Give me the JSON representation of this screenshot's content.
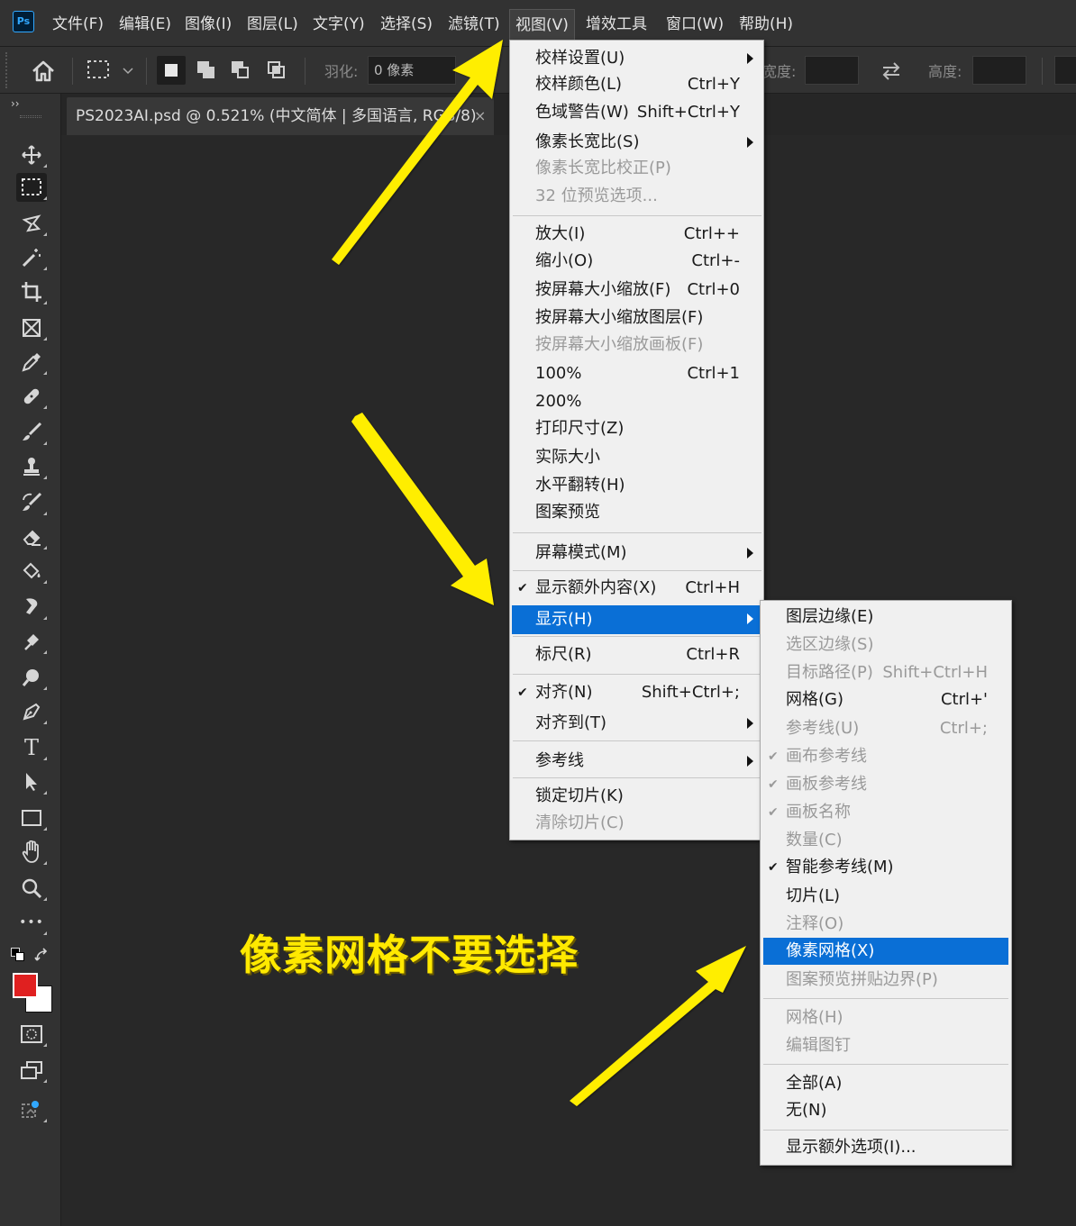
{
  "colors": {
    "accent": "#0a6fd6",
    "annotation": "#ffe900",
    "foreground_swatch": "#e02020",
    "ps_blue": "#31a8ff"
  },
  "app": {
    "logo_text": "Ps"
  },
  "menubar": {
    "items": [
      "文件(F)",
      "编辑(E)",
      "图像(I)",
      "图层(L)",
      "文字(Y)",
      "选择(S)",
      "滤镜(T)",
      "视图(V)",
      "增效工具",
      "窗口(W)",
      "帮助(H)"
    ]
  },
  "options": {
    "feather_label": "羽化:",
    "feather_value": "0 像素",
    "width_label": "宽度:",
    "height_label": "高度:",
    "collapse": "››"
  },
  "document": {
    "tab_title": "PS2023AI.psd @ 0.521% (中文简体 | 多国语言, RGB/8)",
    "close": "×"
  },
  "tools": {
    "icons": [
      "move-tool-icon",
      "marquee-tool-icon",
      "lasso-tool-icon",
      "magic-wand-icon",
      "crop-tool-icon",
      "frame-tool-icon",
      "eyedropper-icon",
      "healing-brush-icon",
      "brush-tool-icon",
      "clone-stamp-icon",
      "history-brush-icon",
      "eraser-icon",
      "paint-bucket-icon",
      "smudge-tool-icon",
      "dodge-tool-icon",
      "zoom-pen-icon",
      "pen-tool-icon",
      "type-tool-icon",
      "path-selection-icon",
      "rectangle-tool-icon",
      "hand-tool-icon",
      "zoom-tool-icon",
      "more-tools-icon"
    ],
    "type_glyph": "T",
    "more_glyph": "•••"
  },
  "view_menu": {
    "items": [
      {
        "label": "校样设置(U)",
        "shortcut": "",
        "submenu": true
      },
      {
        "label": "校样颜色(L)",
        "shortcut": "Ctrl+Y"
      },
      {
        "label": "色域警告(W)",
        "shortcut": "Shift+Ctrl+Y"
      },
      {
        "label": "像素长宽比(S)",
        "shortcut": "",
        "submenu": true
      },
      {
        "label": "像素长宽比校正(P)",
        "shortcut": "",
        "disabled": true
      },
      {
        "label": "32 位预览选项...",
        "shortcut": "",
        "disabled": true
      },
      {
        "label": "放大(I)",
        "shortcut": "Ctrl++"
      },
      {
        "label": "缩小(O)",
        "shortcut": "Ctrl+-"
      },
      {
        "label": "按屏幕大小缩放(F)",
        "shortcut": "Ctrl+0"
      },
      {
        "label": "按屏幕大小缩放图层(F)",
        "shortcut": ""
      },
      {
        "label": "按屏幕大小缩放画板(F)",
        "shortcut": "",
        "disabled": true
      },
      {
        "label": "100%",
        "shortcut": "Ctrl+1"
      },
      {
        "label": "200%",
        "shortcut": ""
      },
      {
        "label": "打印尺寸(Z)",
        "shortcut": ""
      },
      {
        "label": "实际大小",
        "shortcut": ""
      },
      {
        "label": "水平翻转(H)",
        "shortcut": ""
      },
      {
        "label": "图案预览",
        "shortcut": ""
      },
      {
        "label": "屏幕模式(M)",
        "shortcut": "",
        "submenu": true
      },
      {
        "label": "显示额外内容(X)",
        "shortcut": "Ctrl+H",
        "checked": true
      },
      {
        "label": "显示(H)",
        "shortcut": "",
        "submenu": true,
        "highlighted": true
      },
      {
        "label": "标尺(R)",
        "shortcut": "Ctrl+R"
      },
      {
        "label": "对齐(N)",
        "shortcut": "Shift+Ctrl+;",
        "checked": true
      },
      {
        "label": "对齐到(T)",
        "shortcut": "",
        "submenu": true
      },
      {
        "label": "参考线",
        "shortcut": "",
        "submenu": true
      },
      {
        "label": "锁定切片(K)",
        "shortcut": ""
      },
      {
        "label": "清除切片(C)",
        "shortcut": "",
        "disabled": true
      }
    ]
  },
  "show_menu": {
    "items": [
      {
        "label": "图层边缘(E)",
        "shortcut": ""
      },
      {
        "label": "选区边缘(S)",
        "shortcut": "",
        "disabled": true
      },
      {
        "label": "目标路径(P)",
        "shortcut": "Shift+Ctrl+H",
        "disabled": true
      },
      {
        "label": "网格(G)",
        "shortcut": "Ctrl+'"
      },
      {
        "label": "参考线(U)",
        "shortcut": "Ctrl+;",
        "disabled": true
      },
      {
        "label": "画布参考线",
        "shortcut": "",
        "disabled": true,
        "checked": true
      },
      {
        "label": "画板参考线",
        "shortcut": "",
        "disabled": true,
        "checked": true
      },
      {
        "label": "画板名称",
        "shortcut": "",
        "disabled": true,
        "checked": true
      },
      {
        "label": "数量(C)",
        "shortcut": "",
        "disabled": true
      },
      {
        "label": "智能参考线(M)",
        "shortcut": "",
        "checked": true
      },
      {
        "label": "切片(L)",
        "shortcut": ""
      },
      {
        "label": "注释(O)",
        "shortcut": "",
        "disabled": true
      },
      {
        "label": "像素网格(X)",
        "shortcut": "",
        "highlighted": true
      },
      {
        "label": "图案预览拼贴边界(P)",
        "shortcut": "",
        "disabled": true
      },
      {
        "label": "网格(H)",
        "shortcut": "",
        "disabled": true
      },
      {
        "label": "编辑图钉",
        "shortcut": "",
        "disabled": true
      },
      {
        "label": "全部(A)",
        "shortcut": ""
      },
      {
        "label": "无(N)",
        "shortcut": ""
      },
      {
        "label": "显示额外选项(I)...",
        "shortcut": ""
      }
    ]
  },
  "annotation": {
    "text": "像素网格不要选择"
  }
}
